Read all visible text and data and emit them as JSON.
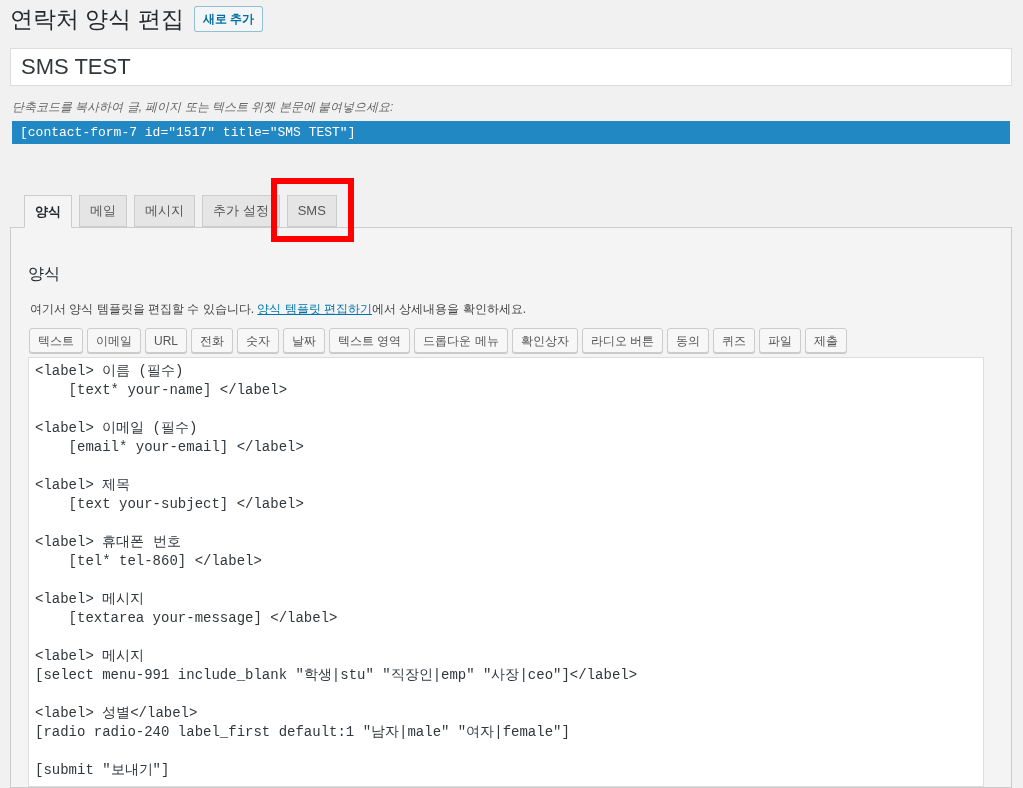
{
  "page_title": "연락처 양식 편집",
  "add_new_button": "새로 추가",
  "form_title": {
    "value": "SMS TEST"
  },
  "shortcode_hint": "단축코드를 복사하여 글, 페이지 또는 텍스트 위젯 본문에 붙여넣으세요:",
  "shortcode": "[contact-form-7 id=\"1517\" title=\"SMS TEST\"]",
  "tabs": [
    {
      "label": "양식",
      "selected": true,
      "highlighted": false
    },
    {
      "label": "메일",
      "selected": false,
      "highlighted": false
    },
    {
      "label": "메시지",
      "selected": false,
      "highlighted": false
    },
    {
      "label": "추가 설정",
      "selected": false,
      "highlighted": false
    },
    {
      "label": "SMS",
      "selected": false,
      "highlighted": true
    }
  ],
  "panel": {
    "heading": "양식",
    "description_before": "여기서 양식 템플릿을 편집할 수 있습니다. ",
    "description_link": "양식 템플릿 편집하기",
    "description_after": "에서 상세내용을 확인하세요.",
    "tag_buttons": [
      "텍스트",
      "이메일",
      "URL",
      "전화",
      "숫자",
      "날짜",
      "텍스트 영역",
      "드롭다운 메뉴",
      "확인상자",
      "라디오 버튼",
      "동의",
      "퀴즈",
      "파일",
      "제출"
    ],
    "editor": {
      "value": "<label> 이름 (필수)\n    [text* your-name] </label>\n\n<label> 이메일 (필수)\n    [email* your-email] </label>\n\n<label> 제목\n    [text your-subject] </label>\n\n<label> 휴대폰 번호\n    [tel* tel-860] </label>\n\n<label> 메시지\n    [textarea your-message] </label>\n\n<label> 메시지\n[select menu-991 include_blank \"학생|stu\" \"직장인|emp\" \"사장|ceo\"]</label>\n\n<label> 성별</label>\n[radio radio-240 label_first default:1 \"남자|male\" \"여자|female\"]\n\n[submit \"보내기\"]"
    }
  }
}
